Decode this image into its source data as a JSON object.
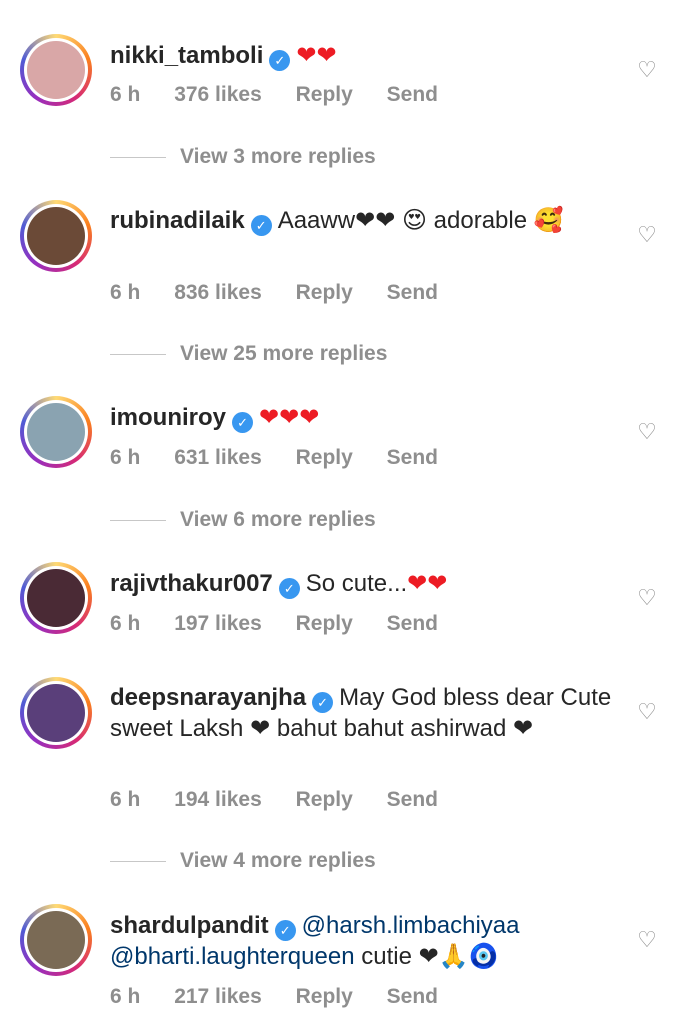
{
  "comments": [
    {
      "username": "nikki_tamboli",
      "text": "",
      "mentions": [],
      "after": "",
      "emoji": "❤❤",
      "time": "6 h",
      "likes": "376 likes",
      "reply": "Reply",
      "send": "Send",
      "view_replies": "View 3 more replies",
      "avatar_color": "#d9a7a7"
    },
    {
      "username": "rubinadilaik",
      "text": "Aaaww",
      "mentions": [],
      "after": "❤❤ 😍 adorable 🥰",
      "emoji": "",
      "time": "6 h",
      "likes": "836 likes",
      "reply": "Reply",
      "send": "Send",
      "view_replies": "View 25 more replies",
      "avatar_color": "#6b4a37"
    },
    {
      "username": "imouniroy",
      "text": "",
      "mentions": [],
      "after": "",
      "emoji": "❤❤❤",
      "time": "6 h",
      "likes": "631 likes",
      "reply": "Reply",
      "send": "Send",
      "view_replies": "View 6 more replies",
      "avatar_color": "#8aa3b1"
    },
    {
      "username": "rajivthakur007",
      "text": "So cute...",
      "mentions": [],
      "after": "❤❤",
      "emoji": "",
      "time": "6 h",
      "likes": "197 likes",
      "reply": "Reply",
      "send": "Send",
      "view_replies": "",
      "avatar_color": "#4a2a35"
    },
    {
      "username": "deepsnarayanjha",
      "text": "May God bless dear Cute sweet Laksh",
      "mentions": [],
      "after": "❤ bahut bahut ashirwad ❤",
      "emoji": "",
      "time": "6 h",
      "likes": "194 likes",
      "reply": "Reply",
      "send": "Send",
      "view_replies": "View 4 more replies",
      "avatar_color": "#5a3f7a"
    },
    {
      "username": "shardulpandit",
      "text": "",
      "mentions": [
        "@harsh.limbachiyaa",
        "@bharti.laughterqueen"
      ],
      "after": "cutie ❤🙏🧿",
      "emoji": "",
      "time": "6 h",
      "likes": "217 likes",
      "reply": "Reply",
      "send": "Send",
      "view_replies": "",
      "avatar_color": "#7a6a55"
    }
  ]
}
